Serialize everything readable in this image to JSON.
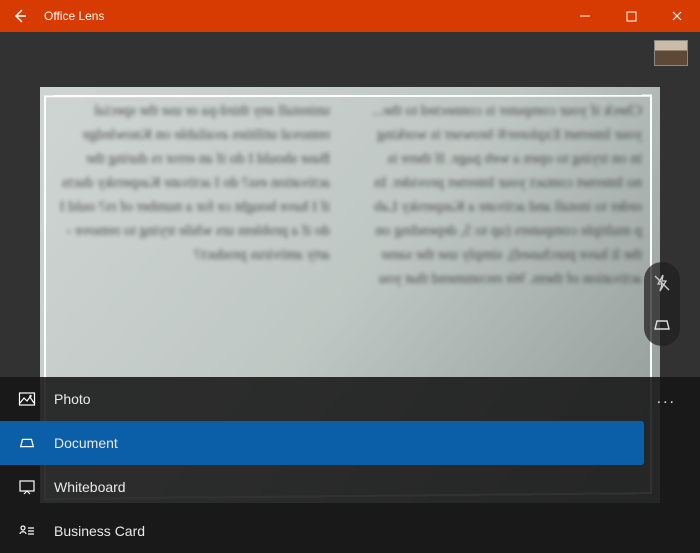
{
  "app": {
    "title": "Office Lens"
  },
  "colors": {
    "titlebar": "#d83b01",
    "selected": "#0b5ea8"
  },
  "modes": {
    "more_label": "...",
    "items": [
      {
        "label": "Photo",
        "icon": "photo-icon",
        "selected": false
      },
      {
        "label": "Document",
        "icon": "document-icon",
        "selected": true
      },
      {
        "label": "Whiteboard",
        "icon": "whiteboard-icon",
        "selected": false
      },
      {
        "label": "Business Card",
        "icon": "business-card-icon",
        "selected": false
      }
    ]
  },
  "side_controls": {
    "flash_icon": "flash-off-icon",
    "scan_icon": "scan-angle-icon"
  },
  "preview": {
    "avatar": "user-thumbnail",
    "blur_text": "Check if your computer is connected to the...\nyour Internet Explorer® browser is working in on\ntrying to open a web page. If there is no Internet\ncontact your Internet provider.\n\nIn order to install and activate a Kaspersky Lab p\nmultiple computers (up to 5, depending on the li\nhave purchased), simply use the same activation\nof them.\n\nWe recommend that you uninstall any third-pa\nor use the special removal utilities available on\n Knowledge Base\n\nshould I do if an error\nrs during the activation\ness?\n\ndo I activate Kaspersky\nducts if I have bought\nce for a number of\nrs?\n\nould I do if a problem\nurs while trying to remove\n-arty antivirus product?"
  }
}
